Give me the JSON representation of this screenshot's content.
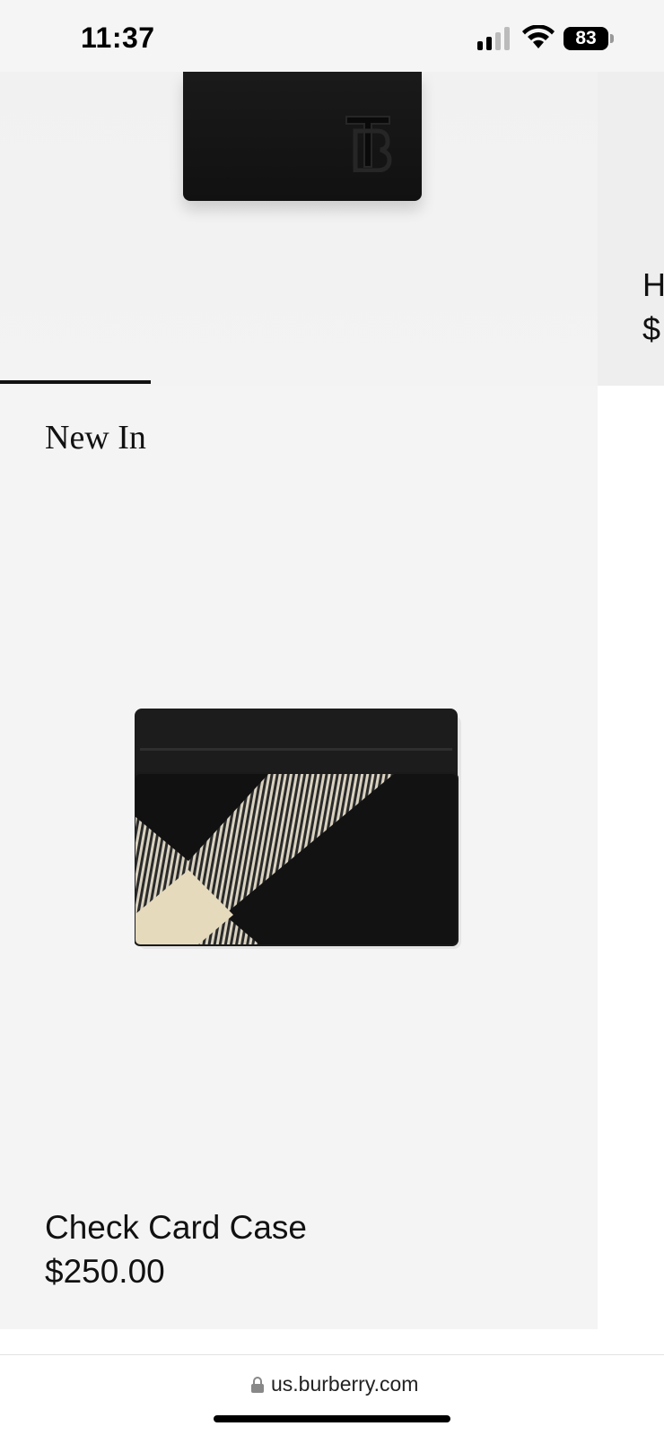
{
  "status_bar": {
    "time": "11:37",
    "battery": "83"
  },
  "top_product": {
    "peek_name": "H",
    "peek_price": "$"
  },
  "section": {
    "title": "New In"
  },
  "product": {
    "name": "Check Card Case",
    "price": "$250.00"
  },
  "browser": {
    "url": "us.burberry.com"
  },
  "colors": {
    "background": "#f4f4f4",
    "text": "#111111",
    "accent_beige": "#e8dcc0"
  }
}
